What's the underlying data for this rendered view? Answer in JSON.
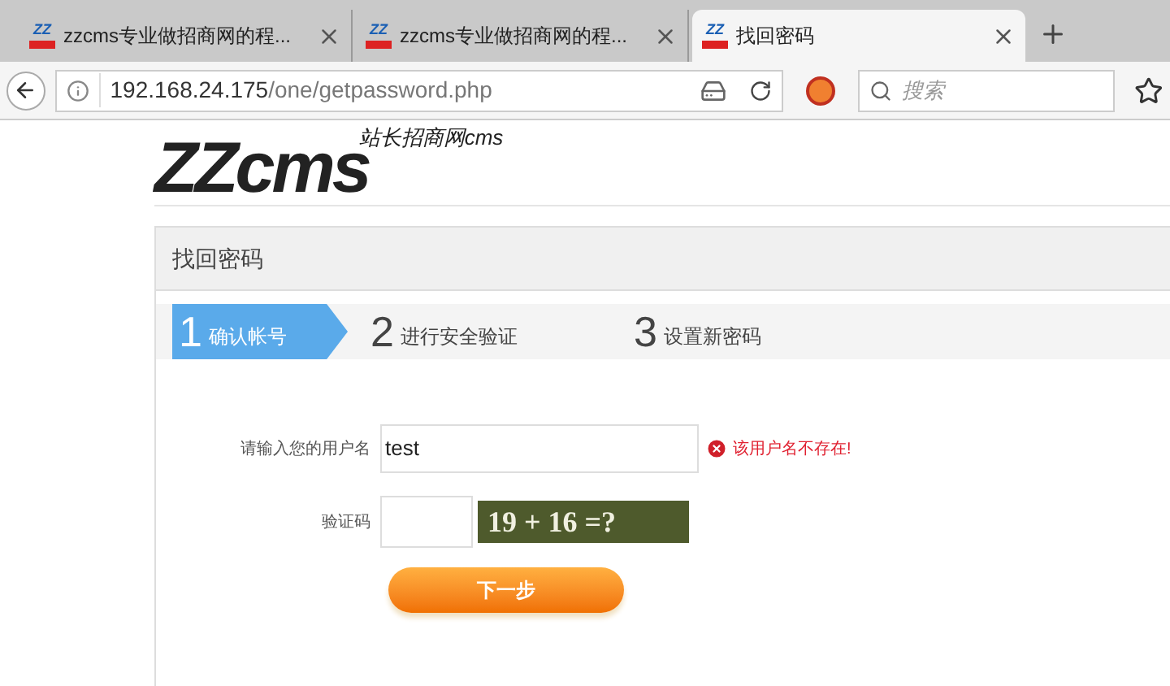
{
  "browser": {
    "tabs": [
      {
        "icon": "ZZ",
        "title": "zzcms专业做招商网的程...",
        "selected": false
      },
      {
        "icon": "ZZ",
        "title": "zzcms专业做招商网的程...",
        "selected": false
      },
      {
        "icon": "ZZ",
        "title": "找回密码",
        "selected": true
      }
    ],
    "address": {
      "host": "192.168.24.175",
      "path": "/one/getpassword.php"
    },
    "search": {
      "placeholder": "搜索"
    }
  },
  "logo": {
    "mark": "ZZcms",
    "tagline": "站长招商网cms"
  },
  "panel": {
    "title": "找回密码"
  },
  "steps": [
    {
      "number": "1",
      "label": "确认帐号",
      "selected": true
    },
    {
      "number": "2",
      "label": "进行安全验证",
      "selected": false
    },
    {
      "number": "3",
      "label": "设置新密码",
      "selected": false
    }
  ],
  "form": {
    "username": {
      "label": "请输入您的用户名",
      "value": "test",
      "error": "该用户名不存在!"
    },
    "captcha": {
      "label": "验证码",
      "question": "19 + 16 =?"
    },
    "submit": "下一步"
  }
}
